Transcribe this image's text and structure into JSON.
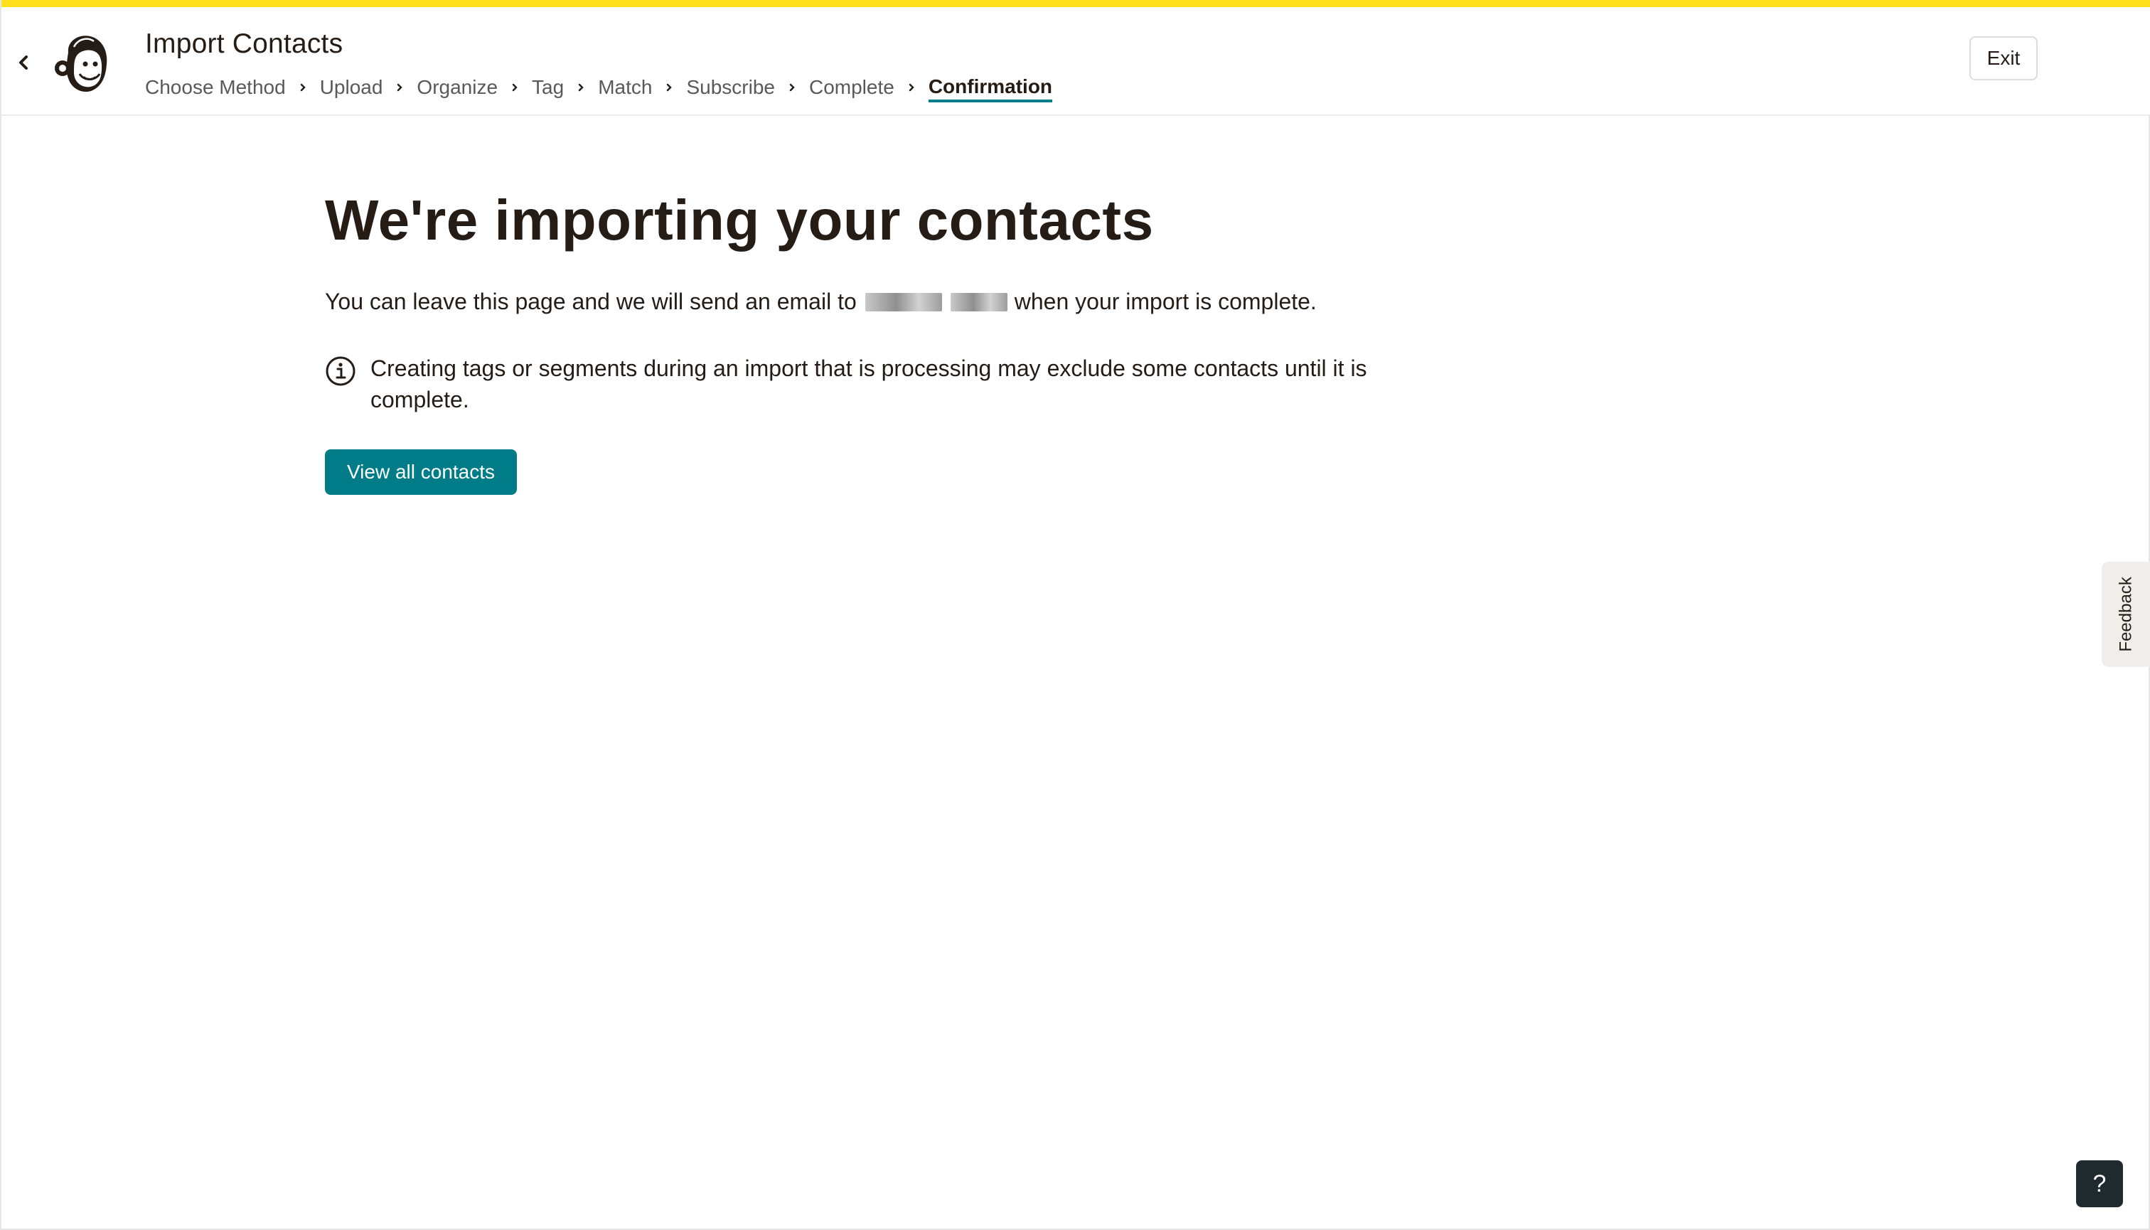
{
  "colors": {
    "accent_bar": "#ffe01b",
    "primary": "#007c89",
    "text": "#241c15",
    "muted_text": "#595959"
  },
  "header": {
    "back_icon": "chevron-left-icon",
    "logo": "mailchimp-freddie-logo",
    "title": "Import Contacts",
    "steps": [
      {
        "label": "Choose Method",
        "active": false
      },
      {
        "label": "Upload",
        "active": false
      },
      {
        "label": "Organize",
        "active": false
      },
      {
        "label": "Tag",
        "active": false
      },
      {
        "label": "Match",
        "active": false
      },
      {
        "label": "Subscribe",
        "active": false
      },
      {
        "label": "Complete",
        "active": false
      },
      {
        "label": "Confirmation",
        "active": true
      }
    ],
    "step_separator_icon": "chevron-right-icon",
    "exit_label": "Exit"
  },
  "main": {
    "heading": "We're importing your contacts",
    "lead_before": "You can leave this page and we will send an email to",
    "lead_after": "when your import is complete.",
    "notice_icon": "info-icon",
    "notice_text": "Creating tags or segments during an import that is processing may exclude some contacts until it is complete.",
    "button_label": "View all contacts"
  },
  "feedback_label": "Feedback",
  "help_label": "?"
}
